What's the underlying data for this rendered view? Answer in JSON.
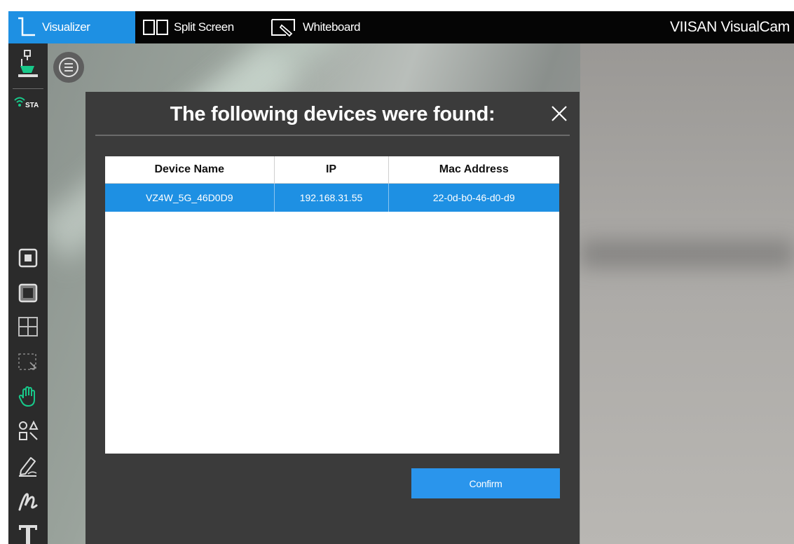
{
  "topbar": {
    "tabs": [
      {
        "label": "Visualizer",
        "icon": "visualizer-icon",
        "active": true
      },
      {
        "label": "Split Screen",
        "icon": "split-screen-icon",
        "active": false
      },
      {
        "label": "Whiteboard",
        "icon": "whiteboard-icon",
        "active": false
      }
    ],
    "app_title": "VIISAN VisualCam"
  },
  "sidebar": {
    "items": [
      {
        "icon": "document-camera-icon"
      },
      {
        "icon": "wifi-icon",
        "label": "STA"
      },
      {
        "icon": "stop-icon"
      },
      {
        "icon": "frame-icon"
      },
      {
        "icon": "grid-icon"
      },
      {
        "icon": "select-area-icon"
      },
      {
        "icon": "hand-icon"
      },
      {
        "icon": "shapes-icon"
      },
      {
        "icon": "pen-icon"
      },
      {
        "icon": "freehand-icon"
      },
      {
        "icon": "text-icon"
      }
    ]
  },
  "dialog": {
    "title": "The following devices were found:",
    "columns": [
      "Device Name",
      "IP",
      "Mac Address"
    ],
    "rows": [
      {
        "device_name": "VZ4W_5G_46D0D9",
        "ip": "192.168.31.55",
        "mac": "22-0d-b0-46-d0-d9",
        "selected": true
      }
    ],
    "confirm_label": "Confirm"
  },
  "colors": {
    "accent": "#1e90e3",
    "toolbar_bg": "#2b2b2b",
    "dialog_bg": "#3b3b3b",
    "active_tool": "#18c98a"
  }
}
